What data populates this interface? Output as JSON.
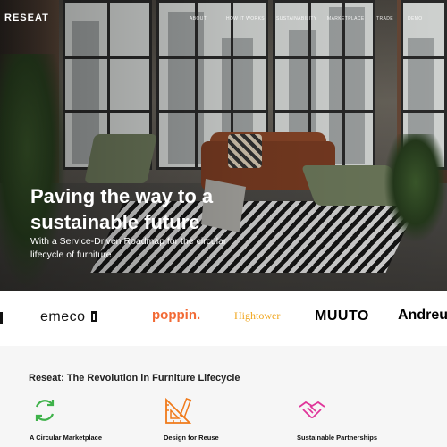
{
  "nav": {
    "logo": "RESEAT",
    "items": [
      {
        "label": "ABOUT"
      },
      {
        "label": "HOW IT WORKS"
      },
      {
        "label": "SUSTAINABILITY"
      },
      {
        "label": "MARKETPLACE"
      },
      {
        "label": "TRADE"
      },
      {
        "label": "DEMO"
      }
    ]
  },
  "hero": {
    "title": "Paving the way to a sustainable future",
    "subtitle": "With a Service-Driven Roadmap for the circular lifecycle of furniture."
  },
  "brands": {
    "emeco": "emeco",
    "poppin": "poppin.",
    "hightower": "Hightower",
    "muuto": "MUUTO",
    "andreu": "Andreu"
  },
  "section": {
    "title": "Reseat: The Revolution in Furniture Lifecycle",
    "features": [
      {
        "label": "A Circular Marketplace",
        "icon": "recycle-arrows-icon",
        "color": "#3fb24a"
      },
      {
        "label": "Design for Reuse",
        "icon": "ruler-pencil-icon",
        "color": "#f07a1a"
      },
      {
        "label": "Sustainable Partnerships",
        "icon": "handshake-icon",
        "color": "#e0359a"
      }
    ]
  }
}
